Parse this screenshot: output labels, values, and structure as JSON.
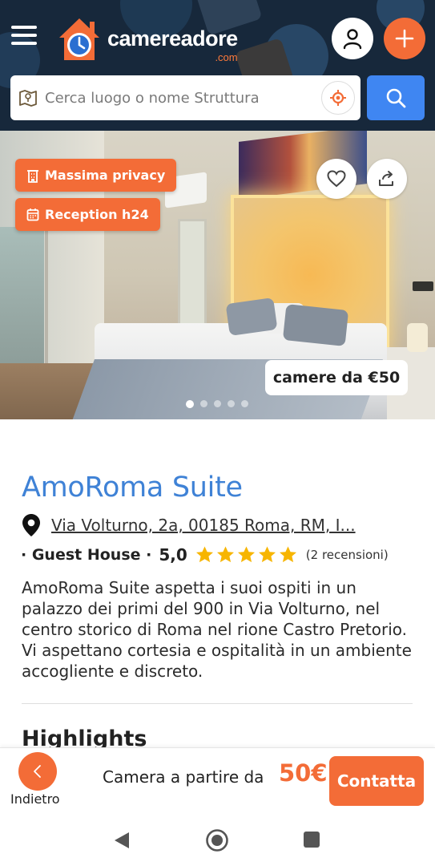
{
  "header": {
    "logo_text": "camereadore",
    "logo_suffix": ".com",
    "search_placeholder": "Cerca luogo o nome Struttura",
    "icons": [
      "menu-icon",
      "user-icon",
      "plus-icon",
      "map-icon",
      "locate-icon",
      "search-icon"
    ]
  },
  "hero": {
    "tags": [
      {
        "label": "Massima privacy",
        "icon": "building-icon"
      },
      {
        "label": "Reception h24",
        "icon": "calendar-icon"
      }
    ],
    "price_badge": "camere da €50",
    "slides_total": 5,
    "slide_active": 1
  },
  "property": {
    "name": "AmoRoma Suite",
    "address": "Via Volturno, 2a, 00185 Roma, RM, I...",
    "type": "· Guest House ·",
    "score": "5,0",
    "stars": 5,
    "reviews": "(2 recensioni)",
    "description": "AmoRoma Suite aspetta i suoi ospiti in un palazzo dei primi del 900 in Via Volturno, nel centro storico di Roma nel rione Castro Pretorio. Vi aspettano cortesia e ospitalità in un ambiente accogliente e discreto.",
    "highlights_heading": "Highlights"
  },
  "bottom_bar": {
    "back_label": "Indietro",
    "price_text": "Camera a partire da",
    "price_amount": "50€",
    "contact_label": "Contatta"
  },
  "colors": {
    "accent": "#f36c37",
    "blue": "#3f86f2",
    "title_blue": "#3f82d6",
    "header_bg": "#17283b",
    "star": "#f7b500"
  }
}
